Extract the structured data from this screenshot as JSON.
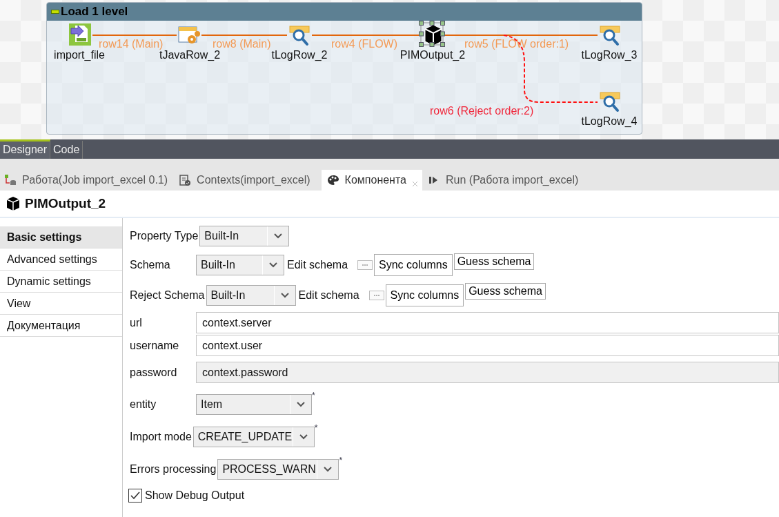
{
  "subjob": {
    "title": "Load 1 level"
  },
  "nodes": [
    {
      "label": "import_file",
      "kind": "excel",
      "selected": false
    },
    {
      "label": "tJavaRow_2",
      "kind": "java",
      "selected": false
    },
    {
      "label": "tLogRow_2",
      "kind": "log",
      "selected": false
    },
    {
      "label": "PIMOutput_2",
      "kind": "output",
      "selected": true
    },
    {
      "label": "tLogRow_3",
      "kind": "log",
      "selected": false
    },
    {
      "label": "tLogRow_4",
      "kind": "log",
      "selected": false
    }
  ],
  "links": [
    {
      "label": "row14 (Main)",
      "kind": "main"
    },
    {
      "label": "row8 (Main)",
      "kind": "main"
    },
    {
      "label": "row4 (FLOW)",
      "kind": "main"
    },
    {
      "label": "row5 (FLOW order:1)",
      "kind": "main"
    },
    {
      "label": "row6 (Reject order:2)",
      "kind": "reject"
    }
  ],
  "editor_tabs": [
    {
      "label": "Designer",
      "selected": true
    },
    {
      "label": "Code",
      "selected": false
    }
  ],
  "view_tabs": [
    {
      "label": "Работа(Job import_excel 0.1)",
      "kind": "job",
      "selected": false
    },
    {
      "label": "Contexts(import_excel)",
      "kind": "contexts",
      "selected": false
    },
    {
      "label": "Компонента",
      "kind": "component",
      "selected": true
    },
    {
      "label": "Run (Работа import_excel)",
      "kind": "run",
      "selected": false
    }
  ],
  "component": {
    "title": "PIMOutput_2"
  },
  "side_tabs": [
    {
      "label": "Basic settings",
      "selected": true
    },
    {
      "label": "Advanced settings",
      "selected": false
    },
    {
      "label": "Dynamic settings",
      "selected": false
    },
    {
      "label": "View",
      "selected": false
    },
    {
      "label": "Документация",
      "selected": false
    }
  ],
  "settings": [
    {
      "kind": "select",
      "label": "Property Type",
      "value": "Built-In"
    },
    {
      "kind": "schema",
      "label": "Schema",
      "value": "Built-In",
      "edit_label": "Edit schema",
      "buttons": [
        "Sync columns",
        "Guess schema"
      ]
    },
    {
      "kind": "schema",
      "label": "Reject Schema",
      "value": "Built-In",
      "edit_label": "Edit schema",
      "buttons": [
        "Sync columns",
        "Guess schema"
      ]
    },
    {
      "kind": "text",
      "label": "url",
      "value": "context.server",
      "disabled": false
    },
    {
      "kind": "text",
      "label": "username",
      "value": "context.user",
      "disabled": false
    },
    {
      "kind": "text",
      "label": "password",
      "value": "context.password",
      "disabled": true
    },
    {
      "kind": "select",
      "label": "entity",
      "value": "Item",
      "required_mark": "*"
    },
    {
      "kind": "select",
      "label": "Import mode",
      "value": "CREATE_UPDATE",
      "required_mark": "*"
    },
    {
      "kind": "select",
      "label": "Errors processing",
      "value": "PROCESS_WARN",
      "required_mark": "*"
    },
    {
      "kind": "checkbox",
      "label": "Show Debug Output",
      "checked": true
    }
  ]
}
